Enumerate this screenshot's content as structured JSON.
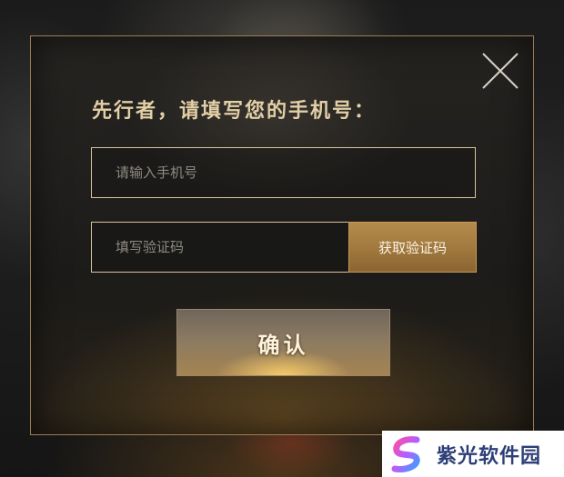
{
  "dialog": {
    "title": "先行者，请填写您的手机号：",
    "phone_input": {
      "placeholder": "请输入手机号",
      "value": ""
    },
    "code_input": {
      "placeholder": "填写验证码",
      "value": ""
    },
    "get_code_label": "获取验证码",
    "confirm_label": "确认",
    "close_icon": "close-icon"
  },
  "watermark": {
    "text": "紫光软件园",
    "logo_icon": "zigu-logo"
  },
  "colors": {
    "accent_gold": "#c89a52",
    "title_gold": "#e3cfa6",
    "field_border": "#d9c49b",
    "watermark_text": "#2e3f77"
  }
}
